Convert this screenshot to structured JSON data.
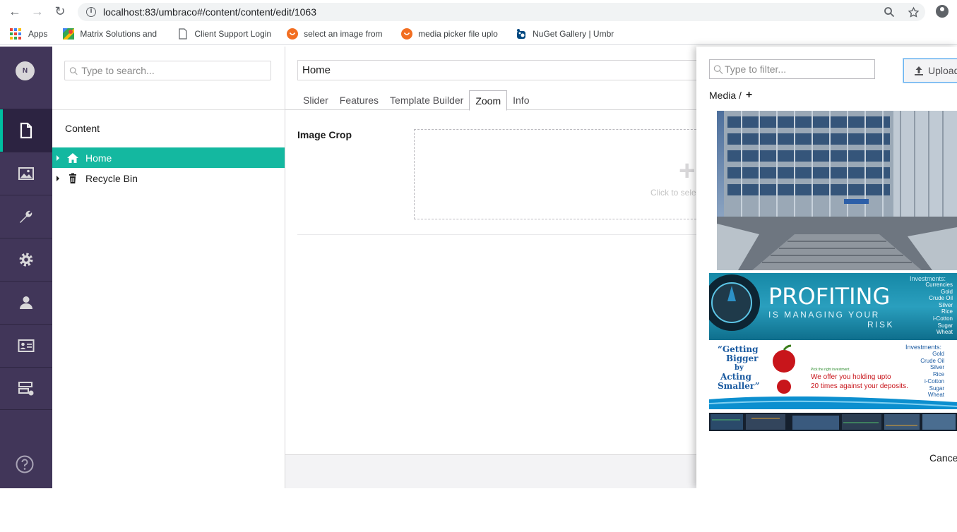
{
  "browser": {
    "url": "localhost:83/umbraco#/content/content/edit/1063",
    "bookmarks": [
      {
        "label": "Apps"
      },
      {
        "label": "Matrix Solutions and"
      },
      {
        "label": "Client Support Login"
      },
      {
        "label": "select an image from"
      },
      {
        "label": "media picker file uplo"
      },
      {
        "label": "NuGet Gallery | Umbr"
      }
    ]
  },
  "sidebar": {
    "avatar_initial": "N",
    "sections": [
      {
        "icon": "document-icon",
        "active": true
      },
      {
        "icon": "image-icon"
      },
      {
        "icon": "wrench-icon"
      },
      {
        "icon": "gear-icon"
      },
      {
        "icon": "user-icon"
      },
      {
        "icon": "member-card-icon"
      },
      {
        "icon": "forms-icon"
      }
    ],
    "help_icon": "help-icon"
  },
  "tree": {
    "search_placeholder": "Type to search...",
    "root_label": "Content",
    "items": [
      {
        "label": "Home",
        "icon": "home-icon",
        "selected": true
      },
      {
        "label": "Recycle Bin",
        "icon": "trash-icon"
      }
    ]
  },
  "editor": {
    "node_name": "Home",
    "tabs": [
      "Slider",
      "Features",
      "Template Builder",
      "Zoom",
      "Info"
    ],
    "active_tab": "Zoom",
    "property_label": "Image Crop",
    "dropzone_text": "Click to sele"
  },
  "media_picker": {
    "filter_placeholder": "Type to filter...",
    "upload_label": "Upload",
    "breadcrumb_root": "Media /",
    "breadcrumb_add": "+",
    "images": [
      {
        "kind": "building-photo"
      },
      {
        "kind": "profiting-banner",
        "headline": "PROFITING",
        "sub1": "IS MANAGING YOUR",
        "sub2": "RISK",
        "list_title": "Investments:",
        "list": [
          "Currencies",
          "Gold",
          "Crude Oil",
          "Silver",
          "Rice",
          "i-Cotton",
          "Sugar",
          "Wheat"
        ]
      },
      {
        "kind": "apple-banner",
        "quote1": "“Getting",
        "quote2": "Bigger",
        "quote3": "by",
        "quote4": "Acting",
        "quote5": "Smaller”",
        "small": "Pick the right investment.",
        "offer1": "We offer you holding upto",
        "offer2": "20 times against your deposits.",
        "list_title": "Investments:",
        "list": [
          "Gold",
          "Crude Oil",
          "Silver",
          "Rice",
          "i-Cotton",
          "Sugar",
          "Wheat"
        ]
      },
      {
        "kind": "trading-screens"
      }
    ],
    "cancel_label": "Cance"
  },
  "colors": {
    "sidebar_bg": "#413659",
    "tree_selected": "#14b8a0",
    "upload_border": "#6ab4f0"
  }
}
